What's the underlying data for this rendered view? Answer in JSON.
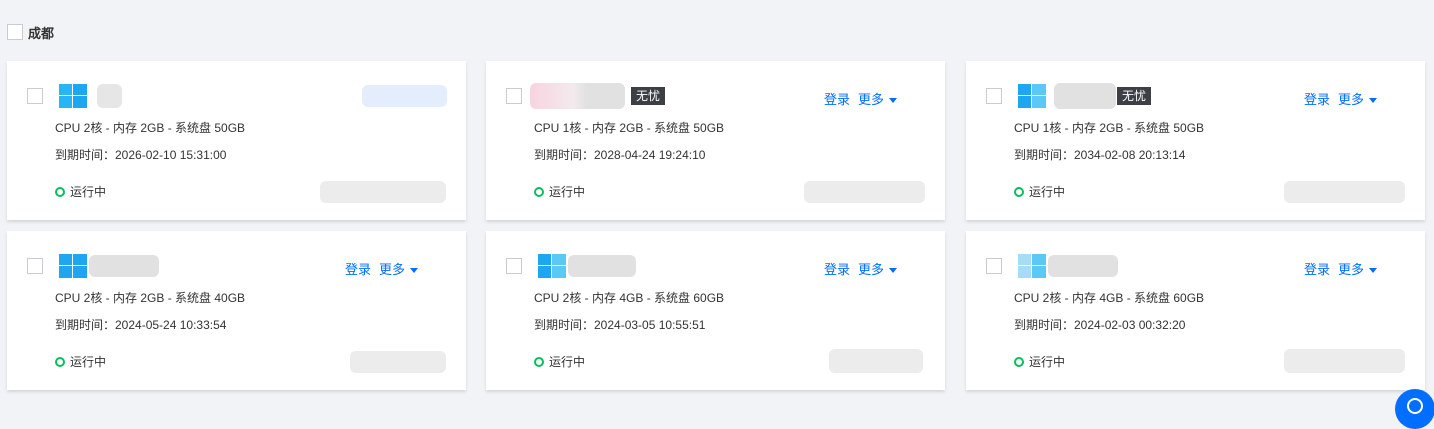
{
  "region": {
    "label": "成都"
  },
  "colors": {
    "accent": "#006eff",
    "status_running": "#0abf5b",
    "badge_bg": "#3d3f47",
    "windows_icon": "#1fa6f0"
  },
  "instances": [
    {
      "os_icon": "windows-icon",
      "spec": "CPU 2核 - 内存 2GB - 系统盘 50GB",
      "expire": "到期时间：2026-02-10 15:31:00",
      "status": "运行中"
    },
    {
      "os_icon": "windows-icon",
      "badge": "无忧",
      "login": "登录",
      "more": "更多",
      "spec": "CPU 1核 - 内存 2GB - 系统盘 50GB",
      "expire": "到期时间：2028-04-24 19:24:10",
      "status": "运行中"
    },
    {
      "os_icon": "windows-icon",
      "badge": "无忧",
      "login": "登录",
      "more": "更多",
      "spec": "CPU 1核 - 内存 2GB - 系统盘 50GB",
      "expire": "到期时间：2034-02-08 20:13:14",
      "status": "运行中"
    },
    {
      "os_icon": "windows-icon",
      "login": "登录",
      "more": "更多",
      "spec": "CPU 2核 - 内存 2GB - 系统盘 40GB",
      "expire": "到期时间：2024-05-24 10:33:54",
      "status": "运行中"
    },
    {
      "os_icon": "windows-icon",
      "login": "登录",
      "more": "更多",
      "spec": "CPU 2核 - 内存 4GB - 系统盘 60GB",
      "expire": "到期时间：2024-03-05 10:55:51",
      "status": "运行中"
    },
    {
      "os_icon": "windows-icon",
      "login": "登录",
      "more": "更多",
      "spec": "CPU 2核 - 内存 4GB - 系统盘 60GB",
      "expire": "到期时间：2024-02-03 00:32:20",
      "status": "运行中"
    }
  ]
}
